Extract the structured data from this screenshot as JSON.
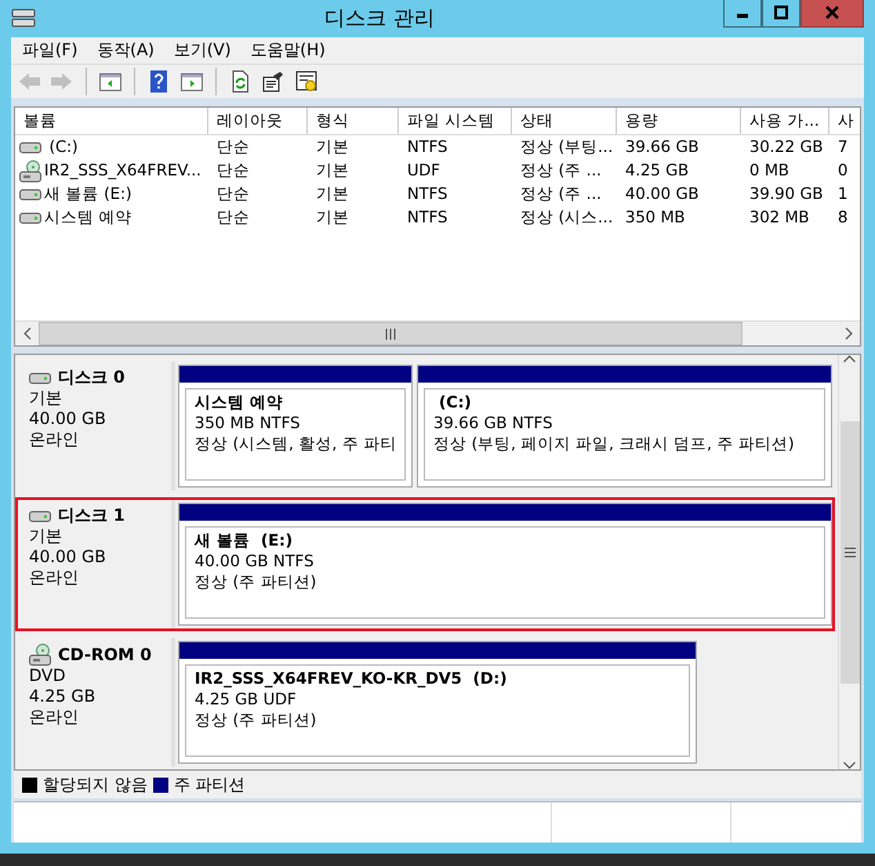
{
  "window": {
    "title": "디스크 관리",
    "controls": [
      {
        "kind": "minimize"
      },
      {
        "kind": "maximize"
      },
      {
        "kind": "close"
      }
    ]
  },
  "menu": [
    "파일(F)",
    "동작(A)",
    "보기(V)",
    "도움말(H)"
  ],
  "toolbar": [
    {
      "kind": "back",
      "disabled": true
    },
    {
      "kind": "forward",
      "disabled": true
    },
    {
      "kind": "sep"
    },
    {
      "kind": "tree",
      "disabled": false
    },
    {
      "kind": "sep"
    },
    {
      "kind": "help",
      "disabled": false
    },
    {
      "kind": "pane",
      "disabled": false
    },
    {
      "kind": "sep"
    },
    {
      "kind": "refresh",
      "disabled": false
    },
    {
      "kind": "properties",
      "disabled": false
    },
    {
      "kind": "settings",
      "disabled": false
    }
  ],
  "volume_table": {
    "columns": [
      "볼륨",
      "레이아웃",
      "형식",
      "파일 시스템",
      "상태",
      "용량",
      "사용 가...",
      "사"
    ],
    "rows": [
      {
        "kind": "disk",
        "cells": [
          " (C:)",
          "단순",
          "기본",
          "NTFS",
          "정상 (부팅...",
          "39.66 GB",
          "30.22 GB",
          "7"
        ]
      },
      {
        "kind": "cdrom",
        "cells": [
          "IR2_SSS_X64FREV...",
          "단순",
          "기본",
          "UDF",
          "정상 (주 ...",
          "4.25 GB",
          "0 MB",
          "0"
        ]
      },
      {
        "kind": "disk",
        "cells": [
          "새 볼륨 (E:)",
          "단순",
          "기본",
          "NTFS",
          "정상 (주 ...",
          "40.00 GB",
          "39.90 GB",
          "1"
        ]
      },
      {
        "kind": "disk",
        "cells": [
          "시스템 예약",
          "단순",
          "기본",
          "NTFS",
          "정상 (시스...",
          "350 MB",
          "302 MB",
          "8"
        ]
      }
    ]
  },
  "disks": [
    {
      "kind": "disk",
      "name": "디스크 0",
      "type": "기본",
      "size": "40.00 GB",
      "status": "온라인",
      "selected": false,
      "partitions": [
        {
          "name": "시스템 예약",
          "size": "350 MB NTFS",
          "status": "정상 (시스템, 활성, 주 파티",
          "color": "#000080"
        },
        {
          "name": " (C:)",
          "size": "39.66 GB NTFS",
          "status": "정상 (부팅, 페이지 파일, 크래시 덤프, 주 파티션)",
          "color": "#000080"
        }
      ]
    },
    {
      "kind": "disk",
      "name": "디스크 1",
      "type": "기본",
      "size": "40.00 GB",
      "status": "온라인",
      "selected": true,
      "partitions": [
        {
          "name": "새 볼륨  (E:)",
          "size": "40.00 GB NTFS",
          "status": "정상 (주 파티션)",
          "color": "#000080"
        }
      ]
    },
    {
      "kind": "cdrom",
      "name": "CD-ROM 0",
      "type": "DVD",
      "size": "4.25 GB",
      "status": "온라인",
      "selected": false,
      "partitions": [
        {
          "name": "IR2_SSS_X64FREV_KO-KR_DV5  (D:)",
          "size": "4.25 GB UDF",
          "status": "정상 (주 파티션)",
          "color": "#000080"
        }
      ]
    }
  ],
  "legend": [
    {
      "label": "할당되지 않음",
      "color": "#000000"
    },
    {
      "label": "주 파티션",
      "color": "#000080"
    }
  ]
}
